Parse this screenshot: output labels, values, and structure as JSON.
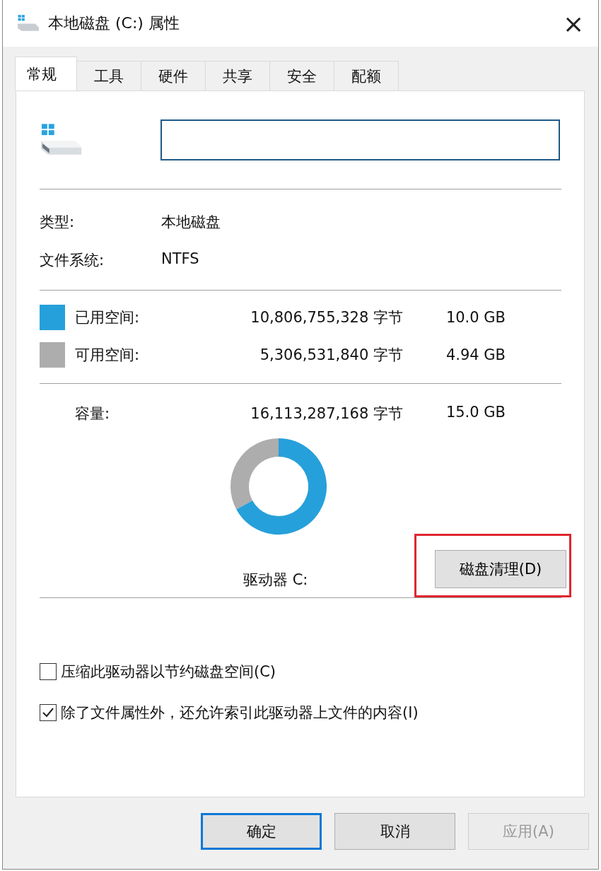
{
  "window": {
    "title": "本地磁盘 (C:) 属性",
    "close": "×"
  },
  "tabs": [
    {
      "label": "常规",
      "selected": true
    },
    {
      "label": "工具",
      "selected": false
    },
    {
      "label": "硬件",
      "selected": false
    },
    {
      "label": "共享",
      "selected": false
    },
    {
      "label": "安全",
      "selected": false
    },
    {
      "label": "配额",
      "selected": false
    }
  ],
  "info": [
    {
      "label": "类型:",
      "value": "本地磁盘"
    },
    {
      "label": "文件系统:",
      "value": "NTFS"
    }
  ],
  "space": [
    {
      "kind": "used",
      "label": "已用空间:",
      "bytes": "10,806,755,328 字节",
      "size": "10.0 GB",
      "color": "#26a0da"
    },
    {
      "kind": "free",
      "label": "可用空间:",
      "bytes": "5,306,531,840 字节",
      "size": "4.94 GB",
      "color": "#adadad"
    }
  ],
  "capacity": {
    "label": "容量:",
    "bytes": "16,113,287,168 字节",
    "size": "15.0 GB"
  },
  "drive_label": "驱动器 C:",
  "cleanup_button": {
    "label": "磁盘清理(D)",
    "highlighted": true
  },
  "options": [
    {
      "label": "压缩此驱动器以节约磁盘空间(C)",
      "checked": false
    },
    {
      "label": "除了文件属性外，还允许索引此驱动器上文件的内容(I)",
      "checked": true
    }
  ],
  "buttons": [
    {
      "label": "确定",
      "default": true,
      "disabled": false
    },
    {
      "label": "取消",
      "default": false,
      "disabled": false
    },
    {
      "label": "应用(A)",
      "default": false,
      "disabled": true
    }
  ]
}
